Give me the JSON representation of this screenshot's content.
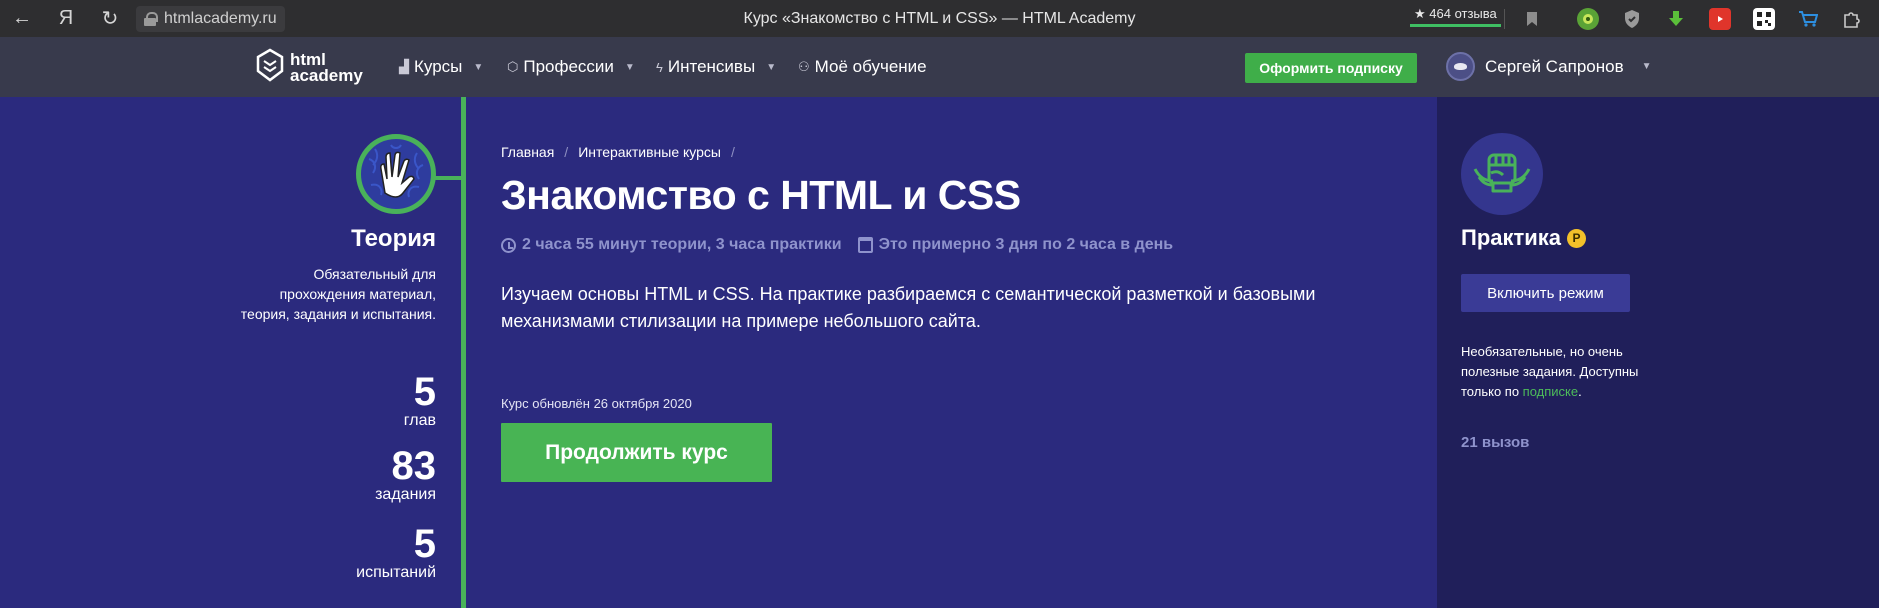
{
  "browser": {
    "url": "htmlacademy.ru",
    "tab_title": "Курс «Знакомство с HTML и CSS» — HTML Academy",
    "reviews": "★ 464 отзыва",
    "back_glyph": "←",
    "yandex_glyph": "Я",
    "reload_glyph": "↻"
  },
  "header": {
    "logo_line1": "html",
    "logo_line2": "academy",
    "nav": [
      {
        "label": "Курсы",
        "icon": "bars-icon"
      },
      {
        "label": "Профессии",
        "icon": "cap-icon"
      },
      {
        "label": "Интенсивы",
        "icon": "bolt-icon"
      },
      {
        "label": "Моё обучение",
        "icon": "people-icon"
      }
    ],
    "subscribe": "Оформить подписку",
    "user_name": "Сергей Сапронов"
  },
  "theory": {
    "title": "Теория",
    "description": "Обязательный для прохождения материал, теория, задания и испытания.",
    "stats": [
      {
        "value": "5",
        "label": "глав"
      },
      {
        "value": "83",
        "label": "задания"
      },
      {
        "value": "5",
        "label": "испытаний"
      }
    ]
  },
  "main": {
    "breadcrumbs": [
      "Главная",
      "Интерактивные курсы"
    ],
    "title": "Знакомство с HTML и CSS",
    "duration": "2 часа 55 минут теории, 3 часа практики",
    "schedule": "Это примерно 3 дня по 2 часа в день",
    "description": "Изучаем основы HTML и CSS. На практике разбираемся с семантической разметкой и базовыми механизмами стилизации на примере небольшого сайта.",
    "updated": "Курс обновлён 26 октября 2020",
    "continue": "Продолжить курс"
  },
  "practice": {
    "title": "Практика",
    "coin": "P",
    "enable": "Включить режим",
    "desc_text": "Необязательные, но очень полезные задания. Доступны только по ",
    "desc_link": "подписке",
    "desc_end": ".",
    "calls": "21 вызов"
  },
  "colors": {
    "accent_green": "#48b454",
    "main_bg": "#2b2a7e",
    "practice_bg": "#201f5a",
    "header_bg": "#383a4c"
  }
}
